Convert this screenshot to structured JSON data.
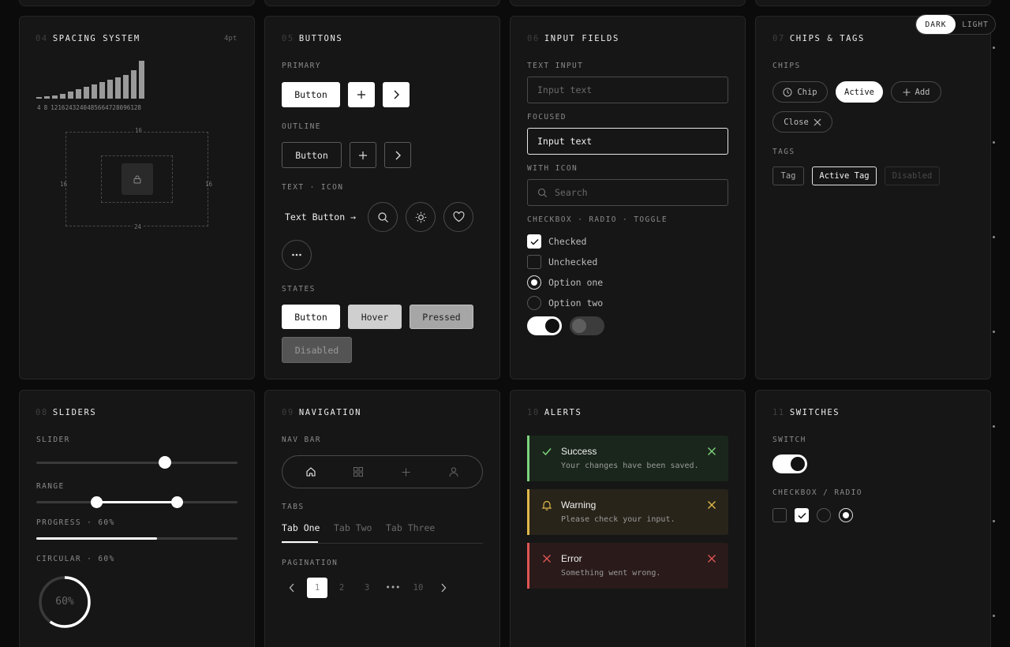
{
  "theme": {
    "dark": "DARK",
    "light": "LIGHT",
    "selected": "dark"
  },
  "spacing": {
    "num": "04",
    "title": "SPACING SYSTEM",
    "unit": "4pt",
    "scale_values": [
      4,
      8,
      12,
      16,
      24,
      32,
      40,
      48,
      56,
      64,
      72,
      80,
      96,
      128
    ],
    "scale_labels": [
      "4",
      "8",
      "12",
      "16",
      "24",
      "32",
      "40",
      "48",
      "56",
      "64",
      "72",
      "80",
      "96",
      "128"
    ],
    "top": "16",
    "left": "16",
    "right": "16",
    "bottom": "24"
  },
  "buttons": {
    "num": "05",
    "title": "BUTTONS",
    "primary_label": "PRIMARY",
    "primary_button": "Button",
    "outline_label": "OUTLINE",
    "outline_button": "Button",
    "text_icon_label": "TEXT · ICON",
    "text_button": "Text Button →",
    "states_label": "STATES",
    "state_default": "Button",
    "state_hover": "Hover",
    "state_pressed": "Pressed",
    "state_disabled": "Disabled"
  },
  "inputs": {
    "num": "06",
    "title": "INPUT FIELDS",
    "text_input_label": "TEXT INPUT",
    "text_input_placeholder": "Input text",
    "focused_label": "FOCUSED",
    "focused_value": "Input text",
    "with_icon_label": "WITH ICON",
    "search_placeholder": "Search",
    "selection_label": "CHECKBOX · RADIO · TOGGLE",
    "checked": "Checked",
    "unchecked": "Unchecked",
    "option_one": "Option one",
    "option_two": "Option two"
  },
  "chips": {
    "num": "07",
    "title": "CHIPS & TAGS",
    "chips_label": "CHIPS",
    "chip": "Chip",
    "active": "Active",
    "add": "Add",
    "close": "Close",
    "tags_label": "TAGS",
    "tag": "Tag",
    "active_tag": "Active Tag",
    "disabled_tag": "Disabled"
  },
  "sliders": {
    "num": "08",
    "title": "SLIDERS",
    "slider_label": "SLIDER",
    "slider_value": 0.64,
    "range_label": "RANGE",
    "range_low": 0.3,
    "range_high": 0.7,
    "progress_label": "PROGRESS · 60%",
    "progress_value": 0.6,
    "circular_label": "CIRCULAR · 60%",
    "circular_text": "60%",
    "circular_value": 0.6
  },
  "navigation": {
    "num": "09",
    "title": "NAVIGATION",
    "navbar_label": "NAV BAR",
    "tabs_label": "TABS",
    "tabs": [
      "Tab One",
      "Tab Two",
      "Tab Three"
    ],
    "pagination_label": "PAGINATION",
    "pages": [
      "1",
      "2",
      "3",
      "10"
    ],
    "ellipsis": "•••"
  },
  "alerts": {
    "num": "10",
    "title": "ALERTS",
    "success_title": "Success",
    "success_msg": "Your changes have been saved.",
    "warning_title": "Warning",
    "warning_msg": "Please check your input.",
    "error_title": "Error",
    "error_msg": "Something went wrong."
  },
  "switches": {
    "num": "11",
    "title": "SWITCHES",
    "switch_label": "SWITCH",
    "cbradio_label": "CHECKBOX / RADIO"
  },
  "colors": {
    "success": "#7ed47e",
    "warning": "#e0b84a",
    "error": "#e05555"
  }
}
